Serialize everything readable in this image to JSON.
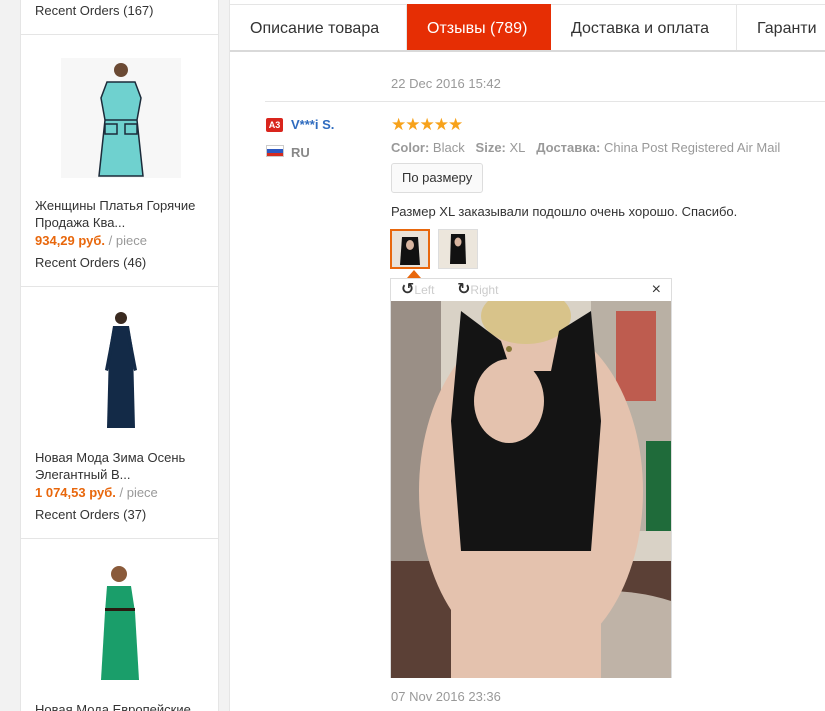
{
  "sidebar": {
    "top_orders": "Recent Orders (167)",
    "items": [
      {
        "title": "Женщины Платья Горячие Продажа Ква...",
        "price": "934,29 руб.",
        "unit": "/ piece",
        "orders": "Recent Orders (46)",
        "dress_color": "#6fd1cf"
      },
      {
        "title": "Новая Мода Зима Осень Элегантный В...",
        "price": "1 074,53 руб.",
        "unit": "/ piece",
        "orders": "Recent Orders (37)",
        "dress_color": "#132a47"
      },
      {
        "title": "Новая Мода Европейские",
        "price": "",
        "unit": "",
        "orders": "",
        "dress_color": "#1a9e6a"
      }
    ]
  },
  "tabs": [
    {
      "label": "Описание товара",
      "active": false
    },
    {
      "label": "Отзывы (789)",
      "active": true
    },
    {
      "label": "Доставка и оплата",
      "active": false
    },
    {
      "label": "Гаранти",
      "active": false
    }
  ],
  "review": {
    "date": "22 Dec 2016 15:42",
    "user_badge": "A3",
    "user_name": "V***i S.",
    "country": "RU",
    "stars": "★★★★★",
    "color_label": "Color:",
    "color_value": "Black",
    "size_label": "Size:",
    "size_value": "XL",
    "delivery_label": "Доставка:",
    "delivery_value": "China Post Registered Air Mail",
    "fit_button": "По размеру",
    "text": "Размер XL заказывали подошло очень хорошо. Спасибо.",
    "viewer": {
      "rotate_left": "Left",
      "rotate_right": "Right",
      "close": "×"
    }
  },
  "next_review_date": "07 Nov 2016 23:36",
  "colors": {
    "accent": "#e62e04",
    "price": "#e8670c",
    "link": "#2e6bbf",
    "star": "#f7a21b"
  }
}
